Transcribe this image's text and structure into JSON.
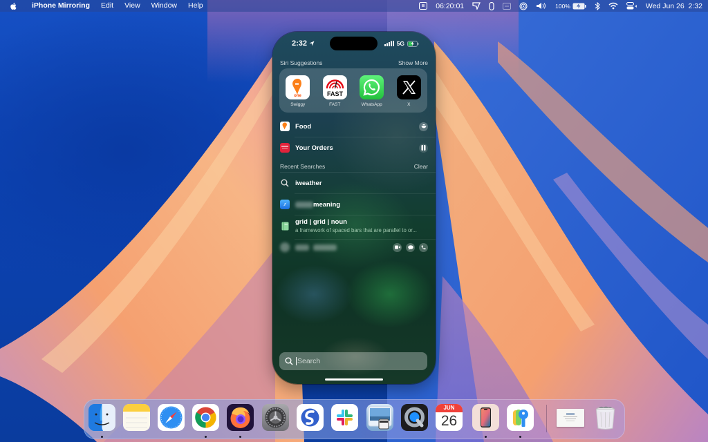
{
  "menubar": {
    "app_name": "iPhone Mirroring",
    "menus": [
      "Edit",
      "View",
      "Window",
      "Help"
    ],
    "timer": "06:20:01",
    "battery_percent": "100%",
    "datetime": "Wed Jun 26  2:32",
    "status_icons": [
      "screen-mirroring-icon",
      "timer-clock",
      "tag-icon",
      "clip-icon",
      "display-icon",
      "airdrop-icon",
      "volume-icon",
      "battery-icon",
      "bluetooth-icon",
      "wifi-icon",
      "control-center-icon"
    ]
  },
  "phone": {
    "status_time": "2:32",
    "network": "5G",
    "siri_suggestions": {
      "title": "Siri Suggestions",
      "show_more": "Show More",
      "apps": [
        {
          "name": "Swiggy"
        },
        {
          "name": "FAST"
        },
        {
          "name": "WhatsApp"
        },
        {
          "name": "X"
        }
      ]
    },
    "shortcuts": [
      {
        "label": "Food",
        "icon": "swiggy-icon"
      },
      {
        "label": "Your Orders",
        "icon": "orders-icon"
      }
    ],
    "recent_searches": {
      "title": "Recent Searches",
      "clear": "Clear",
      "items": [
        {
          "label": "iweather",
          "icon": "search-icon"
        },
        {
          "label": "meaning",
          "icon": "safari-icon",
          "redacted_prefix": true
        },
        {
          "label": "grid | grid | noun",
          "subtitle": "a framework of spaced bars that are parallel to or...",
          "icon": "dictionary-icon"
        }
      ]
    },
    "contact_actions": [
      "video-icon",
      "message-icon",
      "phone-icon"
    ],
    "search": {
      "placeholder": "Search"
    }
  },
  "dock": {
    "apps": [
      {
        "name": "Finder",
        "running": true
      },
      {
        "name": "Notes",
        "running": false
      },
      {
        "name": "Safari",
        "running": false
      },
      {
        "name": "Chrome",
        "running": true
      },
      {
        "name": "Firefox",
        "running": true
      },
      {
        "name": "System Settings",
        "running": false
      },
      {
        "name": "Simplenote",
        "running": false
      },
      {
        "name": "Slack",
        "running": false
      },
      {
        "name": "Preview",
        "running": false
      },
      {
        "name": "QuickTime Player",
        "running": false
      },
      {
        "name": "Calendar",
        "running": false,
        "month": "JUN",
        "day": "26"
      },
      {
        "name": "iPhone Mirroring",
        "running": true
      },
      {
        "name": "Passwords",
        "running": true
      },
      {
        "name": "Document",
        "running": false
      },
      {
        "name": "Trash",
        "running": false
      }
    ]
  }
}
